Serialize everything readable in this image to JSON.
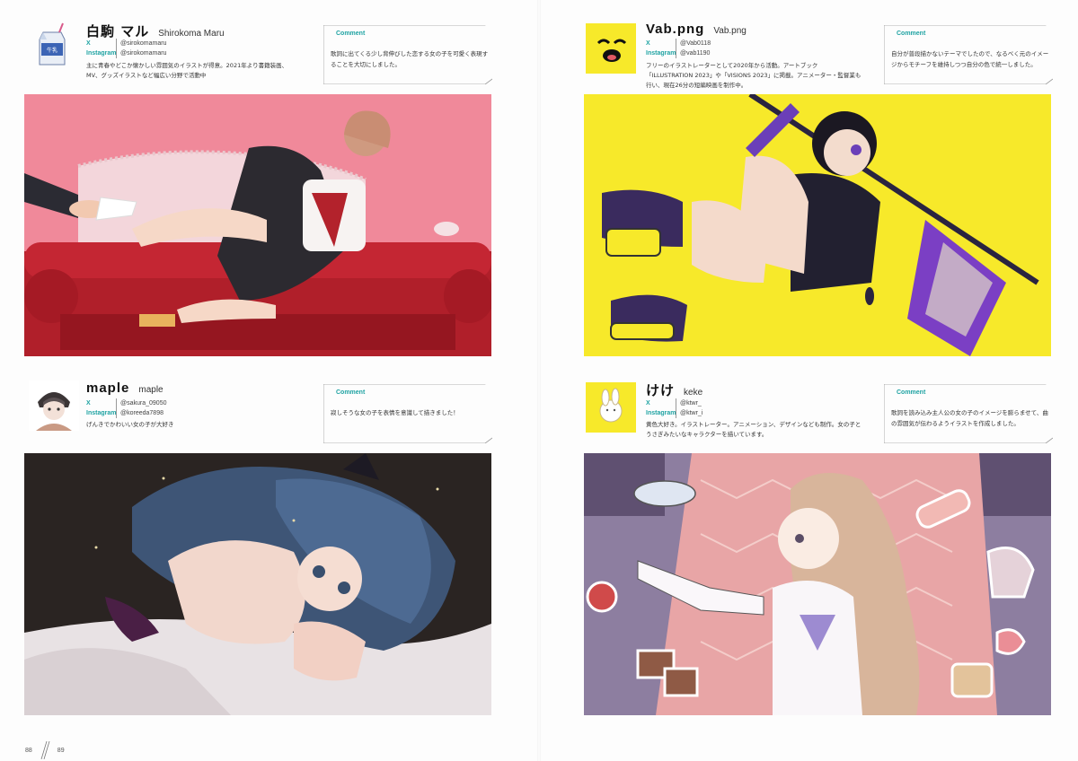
{
  "colors": {
    "accent_teal": "#1fa3a3",
    "pink_bg": "#f0899a",
    "yellow_bg": "#f7e92a",
    "dark_bg": "#2a2422",
    "purple_bg": "#8d7ea0"
  },
  "artists": [
    {
      "name_jp": "白駒 マル",
      "name_romaji": "Shirokoma Maru",
      "x_label": "X",
      "x_handle": "@sirokomamaru",
      "instagram_label": "Instagram",
      "instagram_handle": "@sirokomamaru",
      "bio": "主に青春やどこか懐かしい雰囲気のイラストが得意。2021年より書籍装画、MV、グッズイラストなど幅広い分野で活動中",
      "comment_label": "Comment",
      "comment": "歌詞に出てくる少し背伸びした恋する女の子を可愛く表現することを大切にしました。",
      "avatar_icon": "milk-carton-icon"
    },
    {
      "name_jp": "Vab.png",
      "name_romaji": "Vab.png",
      "x_label": "X",
      "x_handle": "@Vab0118",
      "instagram_label": "Instagram",
      "instagram_handle": "@vab1190",
      "bio": "フリーのイラストレーターとして2020年から活動。アートブック「ILLUSTRATION 2023」や「VISIONS 2023」に掲載。アニメーター・監督業も行い、現在26分の短編映画を制作中。",
      "comment_label": "Comment",
      "comment": "自分が普段描かないテーマでしたので、なるべく元のイメージからモチーフを維持しつつ自分の色で統一しました。",
      "avatar_icon": "yellow-smiley-icon"
    },
    {
      "name_jp": "maple",
      "name_romaji": "maple",
      "x_label": "X",
      "x_handle": "@sakura_09050",
      "instagram_label": "Instagram",
      "instagram_handle": "@koreeda7898",
      "bio": "げんきでかわいい女の子が大好き",
      "comment_label": "Comment",
      "comment": "寂しそうな女の子を表情を意識して描きました！",
      "avatar_icon": "girl-portrait-icon"
    },
    {
      "name_jp": "けけ",
      "name_romaji": "keke",
      "x_label": "X",
      "x_handle": "@ktwr_",
      "instagram_label": "Instagram",
      "instagram_handle": "@ktwr_i",
      "bio": "黄色大好き。イラストレーター。アニメーション、デザインなども制作。女の子とうさぎみたいなキャラクターを描いています。",
      "comment_label": "Comment",
      "comment": "歌詞を読み込み主人公の女の子のイメージを膨らませて、曲の雰囲気が伝わるようイラストを作成しました。",
      "avatar_icon": "bunny-character-icon"
    }
  ],
  "folio": {
    "left_page": "88",
    "right_page": "89"
  }
}
